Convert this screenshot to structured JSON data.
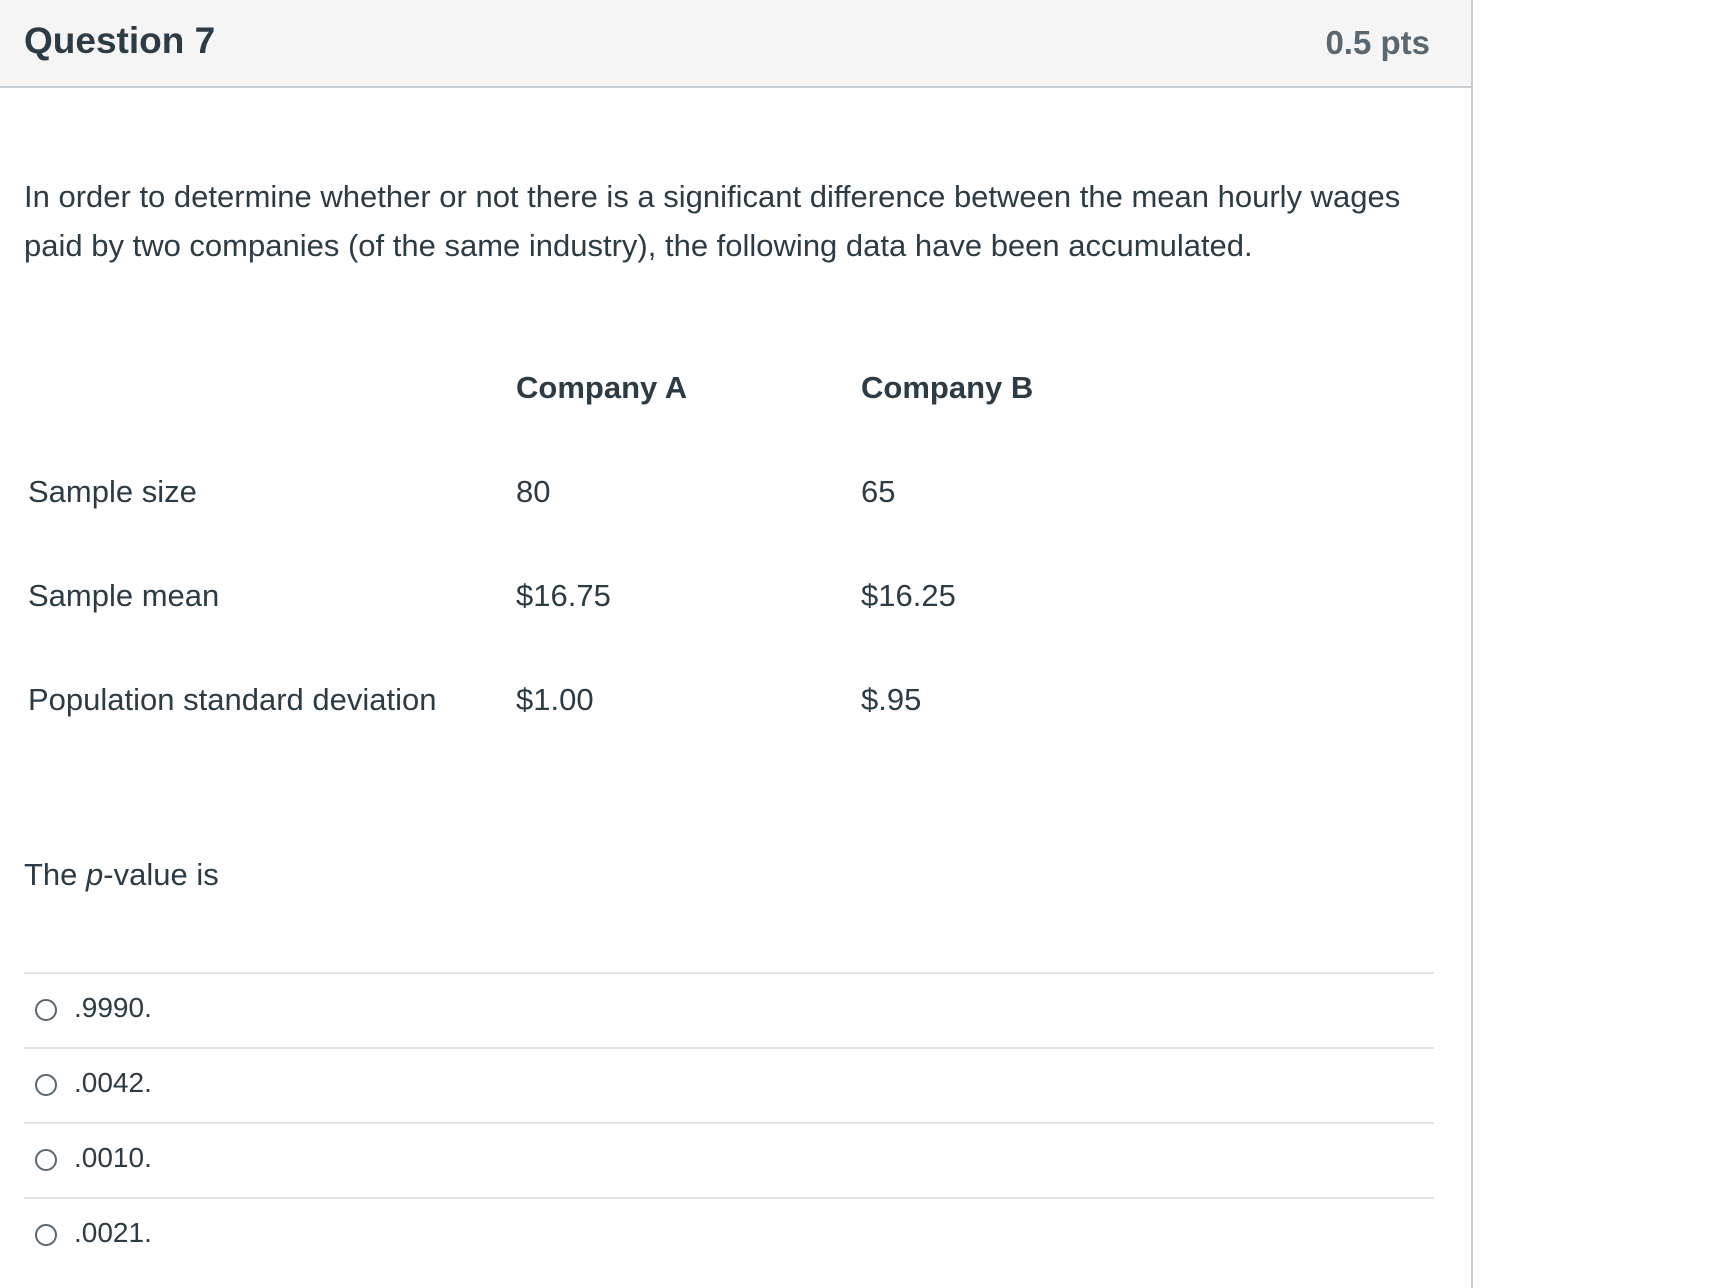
{
  "question": {
    "title": "Question 7",
    "points": "0.5 pts",
    "text": "In order to determine whether or not there is a significant difference between the mean hourly wages paid by two companies (of the same industry), the following data have been accumulated."
  },
  "table": {
    "headers": [
      "",
      "Company A",
      "Company B"
    ],
    "rows": [
      {
        "label": "Sample size",
        "a": "80",
        "b": "65"
      },
      {
        "label": "Sample mean",
        "a": "$16.75",
        "b": "$16.25"
      },
      {
        "label": "Population standard deviation",
        "a": "$1.00",
        "b": "$.95"
      }
    ]
  },
  "prompt": {
    "before": "The ",
    "italic": "p",
    "after": "-value is"
  },
  "answers": [
    {
      "label": ".9990."
    },
    {
      "label": ".0042."
    },
    {
      "label": ".0010."
    },
    {
      "label": ".0021."
    }
  ]
}
